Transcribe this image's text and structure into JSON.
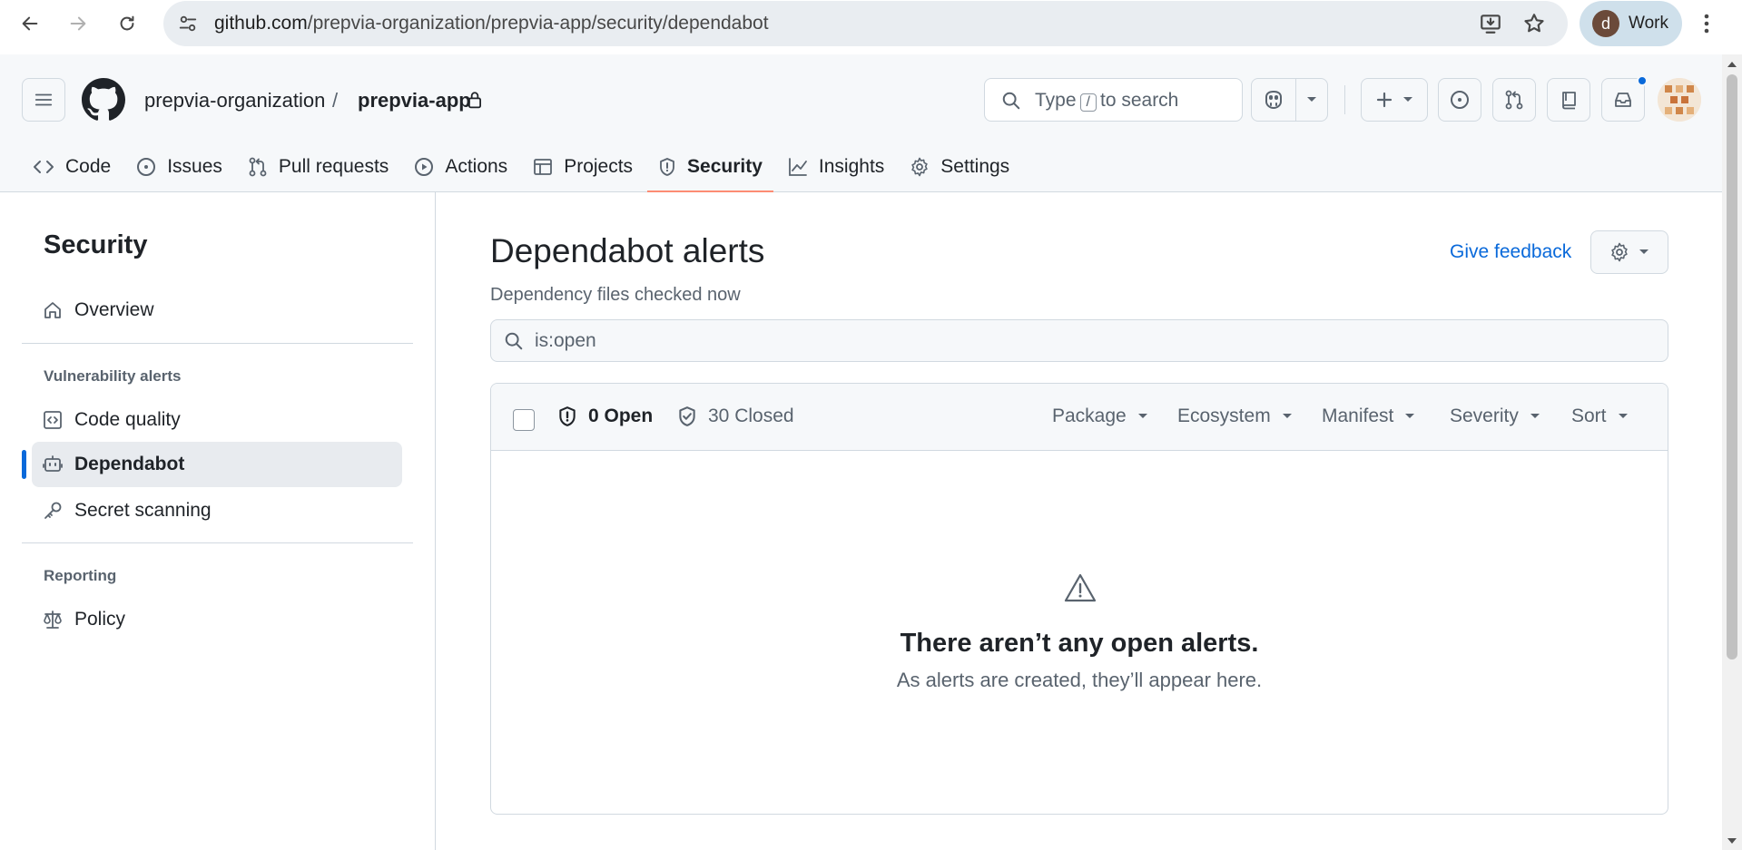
{
  "browser": {
    "url_host": "github.com",
    "url_path": "/prepvia-organization/prepvia-app/security/dependabot",
    "profile_initial": "d",
    "profile_label": "Work"
  },
  "header": {
    "org": "prepvia-organization",
    "separator": "/",
    "repo": "prepvia-app",
    "search_prefix": "Type",
    "search_key": "/",
    "search_suffix": "to search"
  },
  "tabs": [
    {
      "label": "Code",
      "icon": "code-icon"
    },
    {
      "label": "Issues",
      "icon": "issue-icon"
    },
    {
      "label": "Pull requests",
      "icon": "pull-request-icon"
    },
    {
      "label": "Actions",
      "icon": "play-icon"
    },
    {
      "label": "Projects",
      "icon": "table-icon"
    },
    {
      "label": "Security",
      "icon": "shield-icon",
      "active": true
    },
    {
      "label": "Insights",
      "icon": "graph-icon"
    },
    {
      "label": "Settings",
      "icon": "gear-icon"
    }
  ],
  "sidebar": {
    "title": "Security",
    "overview": "Overview",
    "vuln_heading": "Vulnerability alerts",
    "code_quality": "Code quality",
    "dependabot": "Dependabot",
    "secret_scanning": "Secret scanning",
    "reporting_heading": "Reporting",
    "policy": "Policy"
  },
  "main": {
    "title": "Dependabot alerts",
    "subtitle": "Dependency files checked now",
    "feedback": "Give feedback",
    "filter_value": "is:open",
    "open_label": "0 Open",
    "closed_label": "30 Closed",
    "filters": [
      "Package",
      "Ecosystem",
      "Manifest",
      "Severity",
      "Sort"
    ],
    "blank_title": "There aren’t any open alerts.",
    "blank_desc": "As alerts are created, they’ll appear here."
  },
  "colors": {
    "accent": "#0969da",
    "tab_underline": "#fd8c73",
    "header_bg": "#f6f8fa",
    "border": "#d1d9e0"
  }
}
